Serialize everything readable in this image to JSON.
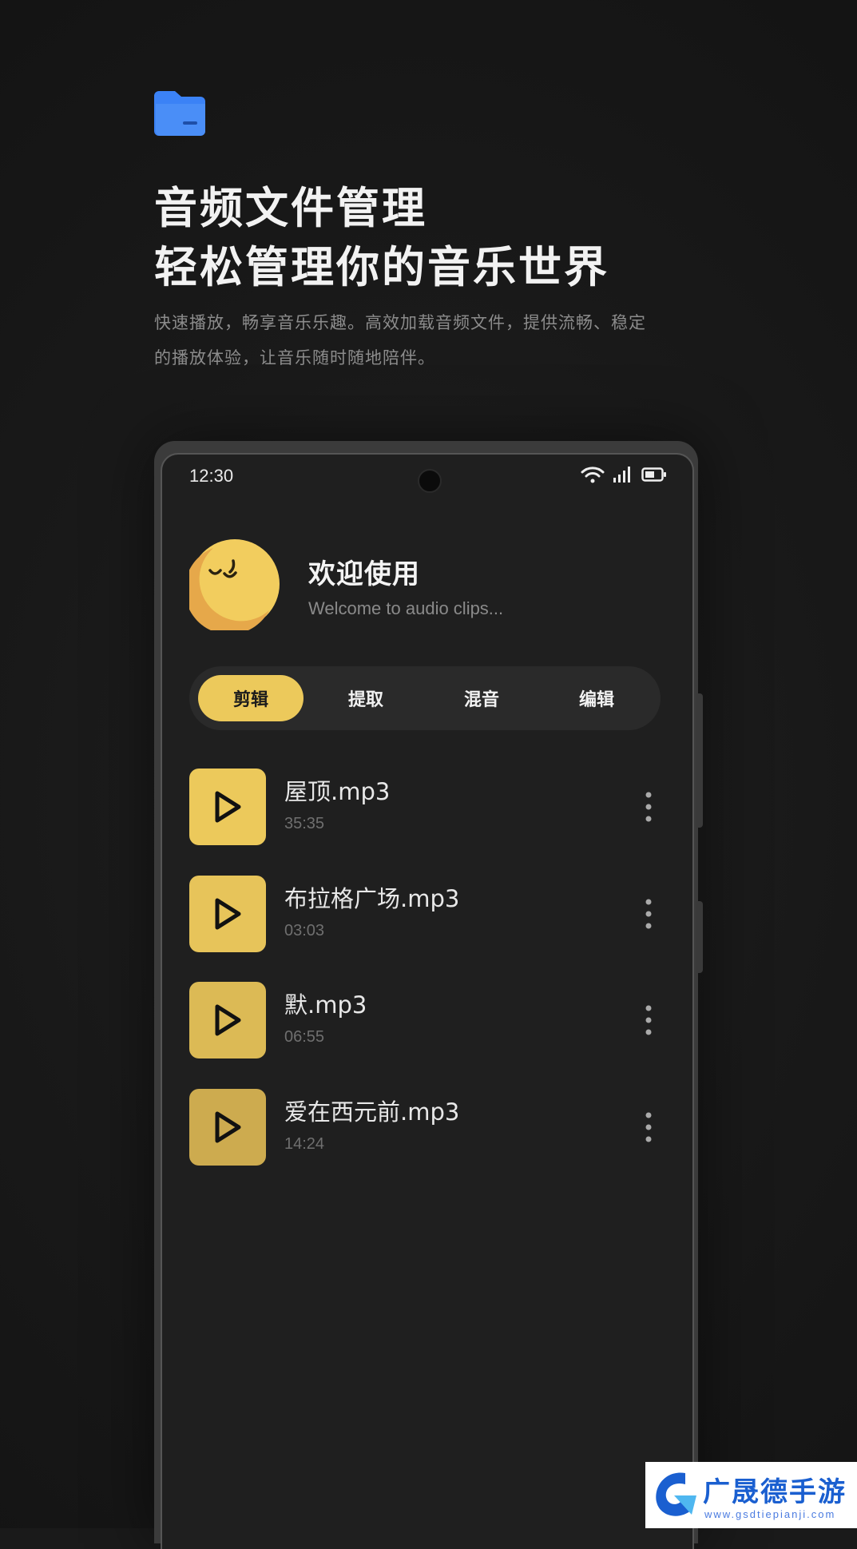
{
  "promo": {
    "title_line1": "音频文件管理",
    "title_line2": "轻松管理你的音乐世界",
    "description_line1": "快速播放，畅享音乐乐趣。高效加载音频文件，提供流畅、稳定",
    "description_line2": "的播放体验，让音乐随时随地陪伴。"
  },
  "status_bar": {
    "time": "12:30"
  },
  "welcome": {
    "title": "欢迎使用",
    "subtitle": "Welcome to audio clips..."
  },
  "tabs": [
    {
      "label": "剪辑",
      "active": true
    },
    {
      "label": "提取",
      "active": false
    },
    {
      "label": "混音",
      "active": false
    },
    {
      "label": "编辑",
      "active": false
    }
  ],
  "tracks": [
    {
      "name": "屋顶.mp3",
      "duration": "35:35"
    },
    {
      "name": "布拉格广场.mp3",
      "duration": "03:03"
    },
    {
      "name": "默.mp3",
      "duration": "06:55"
    },
    {
      "name": "爱在西元前.mp3",
      "duration": "14:24"
    }
  ],
  "watermark": {
    "brand": "广晟德手游",
    "url": "www.gsdtiepianji.com"
  },
  "colors": {
    "accent": "#ecc95b",
    "folder_blue": "#3b82f6",
    "background": "#1a1a1a"
  }
}
